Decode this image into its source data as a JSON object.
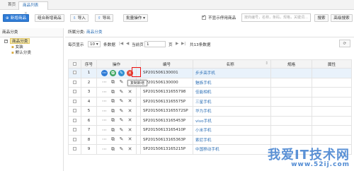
{
  "tabs": [
    {
      "label": "首页"
    },
    {
      "label": "商品列表",
      "close": "×"
    }
  ],
  "toolbar": {
    "add": "新增商品",
    "combo_add": "组合新增商品",
    "import": "导入",
    "export": "导出",
    "batch": "批量操作",
    "batch_arrow": "▾",
    "hide_disabled_label": "不显示停用商品",
    "hide_disabled_checked": true,
    "search_placeholder": "按商编号，名称，条码，规格，关键词…",
    "search_button": "搜索",
    "advanced_search": "高级搜索"
  },
  "left": {
    "title": "商品分类",
    "tree": [
      {
        "label": "商品分类",
        "selected": true
      },
      {
        "label": "女装"
      },
      {
        "label": "默认分类"
      }
    ]
  },
  "right": {
    "title_prefix": "所属分类:",
    "title_crumb": "商品分类"
  },
  "pager": {
    "per_page_label": "每页显示",
    "per_page": "10",
    "per_page_unit": "条数据",
    "first": "|◀",
    "prev": "◀",
    "page_prefix": "当前页",
    "page": "1",
    "page_suffix": "页",
    "next": "▶",
    "last": "▶|",
    "total": "共13条数据",
    "refresh": "⟳"
  },
  "table": {
    "headers": [
      "",
      "序号",
      "操作",
      "",
      "编号",
      "名称",
      "规格",
      "属性"
    ],
    "rows": [
      {
        "idx": "1",
        "code": "SP201506130001",
        "name": "步步高手机"
      },
      {
        "idx": "2",
        "code": "SP201506130000",
        "name": "魅族手机"
      },
      {
        "idx": "3",
        "code": "SP201506131655798",
        "name": "佳能相机"
      },
      {
        "idx": "4",
        "code": "SP20150613165575P",
        "name": "三星手机"
      },
      {
        "idx": "5",
        "code": "SP20150613165572SP",
        "name": "华为手机"
      },
      {
        "idx": "6",
        "code": "SP20150613165453P",
        "name": "vivo手机"
      },
      {
        "idx": "7",
        "code": "SP20150613165410P",
        "name": "小米手机"
      },
      {
        "idx": "8",
        "code": "SP20150613165363P",
        "name": "索尼手机"
      },
      {
        "idx": "9",
        "code": "SP20150613165215P",
        "name": "中国移动手机"
      }
    ]
  },
  "tooltip": "复制新增",
  "watermark": {
    "big": "我爱IT技术网",
    "small": "www.52ij.com"
  },
  "colors": {
    "primary": "#2e7bd6",
    "highlight_box": "#ee1111",
    "selected_node": "#f6e7a7"
  }
}
